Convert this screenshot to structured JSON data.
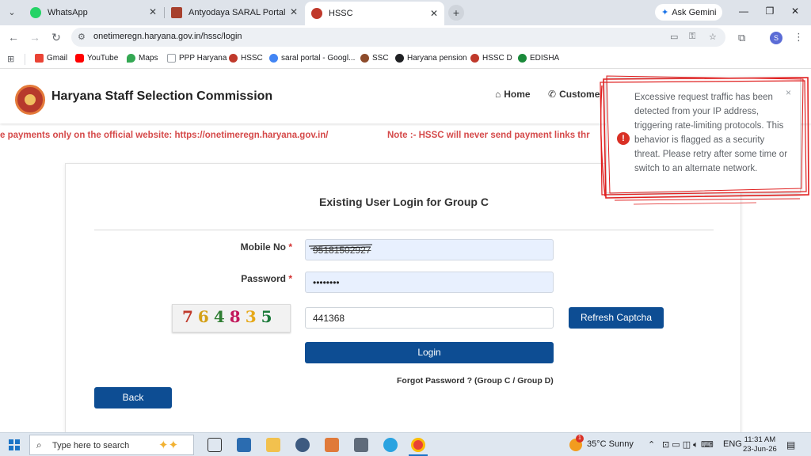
{
  "browser": {
    "tabs": [
      {
        "title": "WhatsApp",
        "active": false,
        "color": "#25d366"
      },
      {
        "title": "Antyodaya SARAL Portal",
        "active": false,
        "color": "#a7402d"
      },
      {
        "title": "HSSC",
        "active": true,
        "color": "#c0392b"
      }
    ],
    "new_tab": "+",
    "gemini_label": "Ask Gemini",
    "window_controls": {
      "minimize": "—",
      "restore": "❐",
      "close": "✕"
    },
    "tab_close": "✕",
    "url": "onetimeregn.haryana.gov.in/hssc/login",
    "profile_initial": "S",
    "bookmarks": [
      {
        "label": "Gmail",
        "color": "#ea4335"
      },
      {
        "label": "YouTube",
        "color": "#ff0000"
      },
      {
        "label": "Maps",
        "color": "#34a853"
      },
      {
        "label": "PPP Haryana",
        "color": "#9aa0a6"
      },
      {
        "label": "HSSC",
        "color": "#c0392b"
      },
      {
        "label": "saral portal - Googl...",
        "color": "#4285f4"
      },
      {
        "label": "SSC",
        "color": "#8d4b2b"
      },
      {
        "label": "Haryana pension",
        "color": "#202124"
      },
      {
        "label": "HSSC D",
        "color": "#c0392b"
      },
      {
        "label": "EDISHA",
        "color": "#1a8a3a"
      }
    ]
  },
  "site": {
    "title": "Haryana Staff Selection Commission",
    "nav": {
      "home": "Home",
      "customer": "Custome"
    },
    "marquee": {
      "part1": "e payments only on the official website: https://onetimeregn.haryana.gov.in/",
      "part2": "Note :- HSSC will never send payment links thr"
    }
  },
  "login": {
    "heading": "Existing User Login for Group C",
    "mobile_label": "Mobile No",
    "password_label": "Password",
    "required_mark": "*",
    "mobile_value": "95181502927",
    "password_value": "••••••••",
    "captcha_text": "764835",
    "captcha_input": "441368",
    "refresh_label": "Refresh Captcha",
    "login_label": "Login",
    "forgot_label": "Forgot Password ? (Group C / Group D)",
    "back_label": "Back"
  },
  "popup": {
    "icon": "!",
    "close": "×",
    "message": "Excessive request traffic has been detected from your IP address, triggering rate-limiting protocols. This behavior is flagged as a security threat. Please retry after some time or switch to an alternate network."
  },
  "taskbar": {
    "search_placeholder": "Type here to search",
    "weather": "35°C  Sunny",
    "language": "ENG",
    "time": "11:31 AM",
    "date": "23-Jun-26",
    "weather_badge": "1"
  }
}
